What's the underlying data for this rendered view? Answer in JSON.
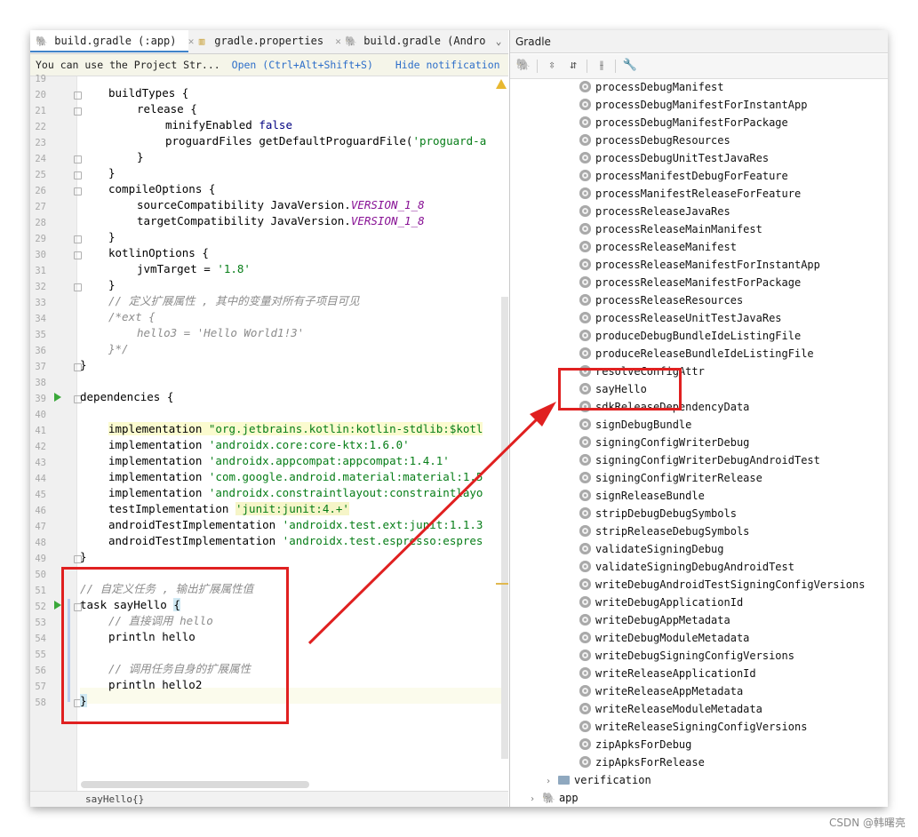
{
  "editor": {
    "tabs": [
      {
        "label": "build.gradle (:app)",
        "active": true
      },
      {
        "label": "gradle.properties",
        "active": false
      },
      {
        "label": "build.gradle (Andro",
        "active": false
      }
    ],
    "notification": {
      "text": "You can use the Project Str...",
      "open_link": "Open (Ctrl+Alt+Shift+S)",
      "hide_link": "Hide notification"
    },
    "line_numbers": [
      "19",
      "20",
      "21",
      "22",
      "23",
      "24",
      "25",
      "26",
      "27",
      "28",
      "29",
      "30",
      "31",
      "32",
      "33",
      "34",
      "35",
      "36",
      "37",
      "38",
      "39",
      "40",
      "41",
      "42",
      "43",
      "44",
      "45",
      "46",
      "47",
      "48",
      "49",
      "50",
      "51",
      "52",
      "53",
      "54",
      "55",
      "56",
      "57",
      "58"
    ],
    "code": {
      "l20": "buildTypes {",
      "l21": "release {",
      "l22a": "minifyEnabled ",
      "l22b": "false",
      "l23a": "proguardFiles getDefaultProguardFile(",
      "l23b": "'proguard-a",
      "l24": "}",
      "l25": "}",
      "l26": "compileOptions {",
      "l27a": "sourceCompatibility JavaVersion.",
      "l27b": "VERSION_1_8",
      "l28a": "targetCompatibility JavaVersion.",
      "l28b": "VERSION_1_8",
      "l29": "}",
      "l30": "kotlinOptions {",
      "l31a": "jvmTarget = ",
      "l31b": "'1.8'",
      "l32": "}",
      "l33": "// 定义扩展属性 , 其中的变量对所有子项目可见",
      "l34": "/*ext {",
      "l35": "hello3 = 'Hello World1!3'",
      "l36": "}*/",
      "l37": "}",
      "l39": "dependencies {",
      "l41a": "implementation ",
      "l41b": "\"org.jetbrains.kotlin:kotlin-stdlib:$kotl",
      "l42a": "implementation ",
      "l42b": "'androidx.core:core-ktx:1.6.0'",
      "l43a": "implementation ",
      "l43b": "'androidx.appcompat:appcompat:1.4.1'",
      "l44a": "implementation ",
      "l44b": "'com.google.android.material:material:1.5",
      "l45a": "implementation ",
      "l45b": "'androidx.constraintlayout:constraintlayo",
      "l46a": "testImplementation ",
      "l46b": "'junit:junit:4.+'",
      "l47a": "androidTestImplementation ",
      "l47b": "'androidx.test.ext:junit:1.1.3",
      "l48a": "androidTestImplementation ",
      "l48b": "'androidx.test.espresso:espres",
      "l49": "}",
      "l51": "// 自定义任务 , 输出扩展属性值",
      "l52a": "task sayHello ",
      "l52b": "{",
      "l53": "// 直接调用 hello",
      "l54": "println hello",
      "l56": "// 调用任务自身的扩展属性",
      "l57": "println hello2",
      "l58": "}"
    },
    "status": "sayHello{}"
  },
  "gradle": {
    "title": "Gradle",
    "tasks": [
      "processDebugManifest",
      "processDebugManifestForInstantApp",
      "processDebugManifestForPackage",
      "processDebugResources",
      "processDebugUnitTestJavaRes",
      "processManifestDebugForFeature",
      "processManifestReleaseForFeature",
      "processReleaseJavaRes",
      "processReleaseMainManifest",
      "processReleaseManifest",
      "processReleaseManifestForInstantApp",
      "processReleaseManifestForPackage",
      "processReleaseResources",
      "processReleaseUnitTestJavaRes",
      "produceDebugBundleIdeListingFile",
      "produceReleaseBundleIdeListingFile",
      "resolveConfigAttr",
      "sayHello",
      "sdkReleaseDependencyData",
      "signDebugBundle",
      "signingConfigWriterDebug",
      "signingConfigWriterDebugAndroidTest",
      "signingConfigWriterRelease",
      "signReleaseBundle",
      "stripDebugDebugSymbols",
      "stripReleaseDebugSymbols",
      "validateSigningDebug",
      "validateSigningDebugAndroidTest",
      "writeDebugAndroidTestSigningConfigVersions",
      "writeDebugApplicationId",
      "writeDebugAppMetadata",
      "writeDebugModuleMetadata",
      "writeDebugSigningConfigVersions",
      "writeReleaseApplicationId",
      "writeReleaseAppMetadata",
      "writeReleaseModuleMetadata",
      "writeReleaseSigningConfigVersions",
      "zipApksForDebug",
      "zipApksForRelease"
    ],
    "verification": "verification",
    "app": "app"
  },
  "watermark": "CSDN @韩曙亮",
  "colors": {
    "annotation": "#e02020",
    "accent": "#4083c9"
  }
}
